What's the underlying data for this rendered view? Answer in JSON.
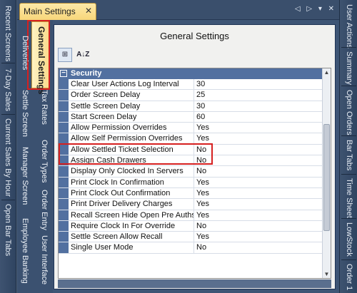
{
  "document_tab": {
    "title": "Main Settings",
    "close": "✕"
  },
  "strip_controls": "◁ ▷ ▾ ✕",
  "left_bar": [
    "Recent Screens",
    "7-Day Sales",
    "Current Sales By Hour",
    "Open Bar Tabs"
  ],
  "right_bar": [
    "User Actions",
    "Summary",
    "Open Orders",
    "Bar Tabs",
    "Time Sheet",
    "LowStock",
    "Order 1"
  ],
  "content_tabs": {
    "active": "General Settings",
    "items": [
      "Deliveries",
      "Settle Screen",
      "Tax Rates",
      "Manager Screen",
      "Order Types",
      "Order Entry",
      "Employee Banking",
      "User Interface"
    ]
  },
  "panel": {
    "title": "General Settings"
  },
  "toolbar": {
    "categorized": "⊞",
    "alphabetical": "A↓Z"
  },
  "grid": {
    "group": "Security",
    "rows": [
      {
        "name": "Clear User Actions Log Interval",
        "value": "30"
      },
      {
        "name": "Order Screen Delay",
        "value": "25"
      },
      {
        "name": "Settle Screen Delay",
        "value": "30"
      },
      {
        "name": "Start Screen Delay",
        "value": "60"
      },
      {
        "name": "Allow Permission Overrides",
        "value": "Yes"
      },
      {
        "name": "Allow Self Permission Overrides",
        "value": "Yes"
      },
      {
        "name": "Allow Settled Ticket Selection",
        "value": "No"
      },
      {
        "name": "Assign Cash Drawers",
        "value": "No"
      },
      {
        "name": "Display Only Clocked In Servers",
        "value": "No"
      },
      {
        "name": "Print Clock In Confirmation",
        "value": "Yes"
      },
      {
        "name": "Print Clock Out Confirmation",
        "value": "Yes"
      },
      {
        "name": "Print Driver Delivery Charges",
        "value": "Yes"
      },
      {
        "name": "Recall Screen Hide Open Pre Auths",
        "value": "Yes"
      },
      {
        "name": "Require Clock In For Override",
        "value": "No"
      },
      {
        "name": "Settle Screen Allow Recall",
        "value": "Yes"
      },
      {
        "name": "Single User Mode",
        "value": "No"
      }
    ]
  },
  "colors": {
    "highlight": "#d62020",
    "group_header": "#5270a0",
    "active_tab": "#f9d98a"
  }
}
